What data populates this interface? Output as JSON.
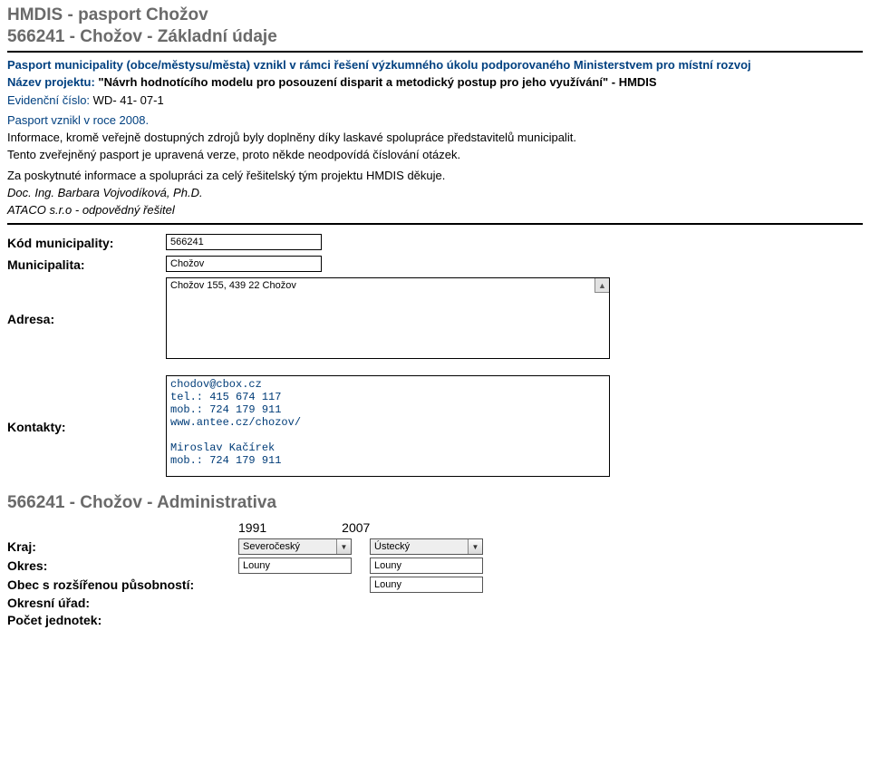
{
  "header": {
    "title": "HMDIS - pasport Chožov",
    "subtitle": "566241 - Chožov - Základní údaje"
  },
  "intro": {
    "line1": "Pasport municipality (obce/městysu/města) vznikl v rámci řešení výzkumného úkolu podporovaného Ministerstvem pro místní rozvoj",
    "nazev_label": "Název projektu: ",
    "nazev_value": "\"Návrh hodnotícího modelu pro posouzení disparit a metodický postup pro jeho využívání\" - HMDIS",
    "evid_label": "Evidenční číslo: ",
    "evid_value": "WD- 41- 07-1",
    "vznik": "Pasport vznikl v roce 2008.",
    "info1": "Informace, kromě veřejně dostupných zdrojů byly doplněny díky laskavé spolupráce představitelů municipalit.",
    "info2": "Tento zveřejněný pasport je upravená verze, proto někde neodpovídá číslování otázek.",
    "thanks": "Za poskytnuté informace a spolupráci za celý řešitelský tým projektu HMDIS děkuje.",
    "sig1": "Doc. Ing. Barbara Vojvodíková, Ph.D.",
    "sig2": "ATACO s.r.o - odpovědný řešitel"
  },
  "form": {
    "kod_label": "Kód municipality:",
    "kod_value": "566241",
    "mun_label": "Municipalita:",
    "mun_value": "Chožov",
    "adresa_label": "Adresa:",
    "adresa_value": "Chožov 155, 439 22 Chožov",
    "kontakty_label": "Kontakty:",
    "kontakty_value": "chodov@cbox.cz\ntel.: 415 674 117\nmob.: 724 179 911\nwww.antee.cz/chozov/\n\nMiroslav Kačírek\nmob.: 724 179 911"
  },
  "admin": {
    "title": "566241 - Chožov - Administrativa",
    "year1": "1991",
    "year2": "2007",
    "kraj_label": "Kraj:",
    "kraj_1991": "Severočeský",
    "kraj_2007": "Ústecký",
    "okres_label": "Okres:",
    "okres_1991": "Louny",
    "okres_2007": "Louny",
    "orp_label": "Obec s rozšířenou působností:",
    "orp_2007": "Louny",
    "ou_label": "Okresní úřad:",
    "pj_label": "Počet jednotek:"
  }
}
